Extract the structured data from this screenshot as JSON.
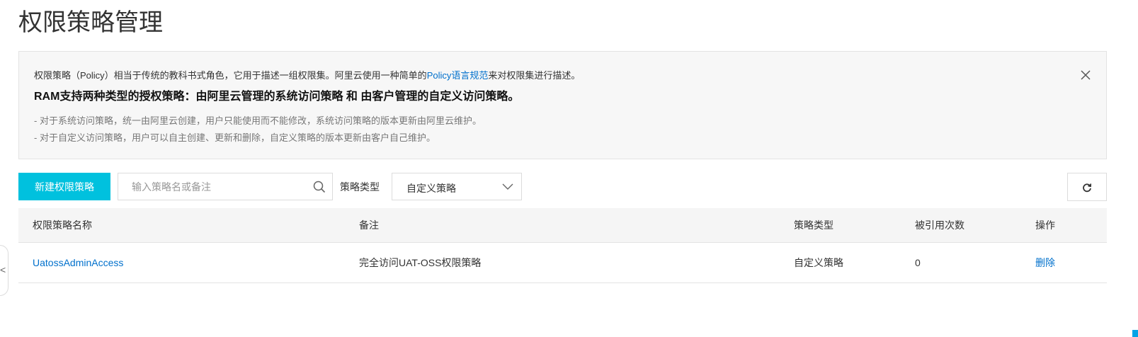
{
  "page": {
    "title": "权限策略管理"
  },
  "notice": {
    "line1_prefix": "权限策略（Policy）相当于传统的教科书式角色，它用于描述一组权限集。阿里云使用一种简单的",
    "line1_link": "Policy语言规范",
    "line1_suffix": "来对权限集进行描述。",
    "line2": "RAM支持两种类型的授权策略：由阿里云管理的系统访问策略 和 由客户管理的自定义访问策略。",
    "line3": "- 对于系统访问策略，统一由阿里云创建，用户只能使用而不能修改，系统访问策略的版本更新由阿里云维护。",
    "line4": "- 对于自定义访问策略，用户可以自主创建、更新和删除，自定义策略的版本更新由客户自己维护。",
    "close_icon": "close-icon"
  },
  "toolbar": {
    "new_button_label": "新建权限策略",
    "search_placeholder": "输入策略名或备注",
    "search_value": "",
    "filter_label": "策略类型",
    "filter_selected": "自定义策略",
    "refresh_icon": "refresh-icon"
  },
  "table": {
    "headers": [
      "权限策略名称",
      "备注",
      "策略类型",
      "被引用次数",
      "操作"
    ],
    "rows": [
      {
        "name": "UatossAdminAccess",
        "remark": "完全访问UAT-OSS权限策略",
        "type": "自定义策略",
        "ref_count": "0",
        "action": "删除"
      }
    ]
  },
  "side": {
    "collapse_glyph": "<"
  },
  "colors": {
    "primary_button": "#00c1de",
    "link": "#0070cc",
    "notice_bg": "#f7f7f7",
    "table_header_bg": "#f5f5f5"
  }
}
